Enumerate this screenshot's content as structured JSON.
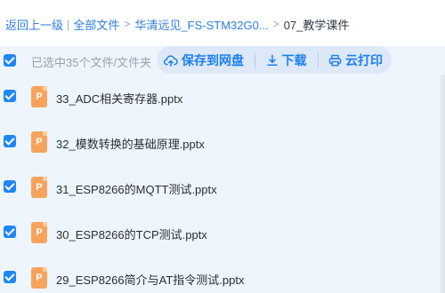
{
  "breadcrumb": {
    "back": "返回上一级",
    "separator": "|",
    "all_files": "全部文件",
    "folder": "华清远见_FS-STM32G0...",
    "arrow": ">",
    "current": "07_教学课件"
  },
  "toolbar": {
    "selected_text": "已选中35个文件/文件夹",
    "save_label": "保存到网盘",
    "download_label": "下载",
    "print_label": "云打印"
  },
  "files": [
    {
      "icon_letter": "P",
      "name": "33_ADC相关寄存器.pptx"
    },
    {
      "icon_letter": "P",
      "name": "32_模数转换的基础原理.pptx"
    },
    {
      "icon_letter": "P",
      "name": "31_ESP8266的MQTT测试.pptx"
    },
    {
      "icon_letter": "P",
      "name": "30_ESP8266的TCP测试.pptx"
    },
    {
      "icon_letter": "P",
      "name": "29_ESP8266简介与AT指令测试.pptx"
    }
  ],
  "colors": {
    "accent": "#1f87f3",
    "link": "#2e7de0",
    "ppt_icon": "#f7a35c",
    "background": "#eef5fd"
  }
}
